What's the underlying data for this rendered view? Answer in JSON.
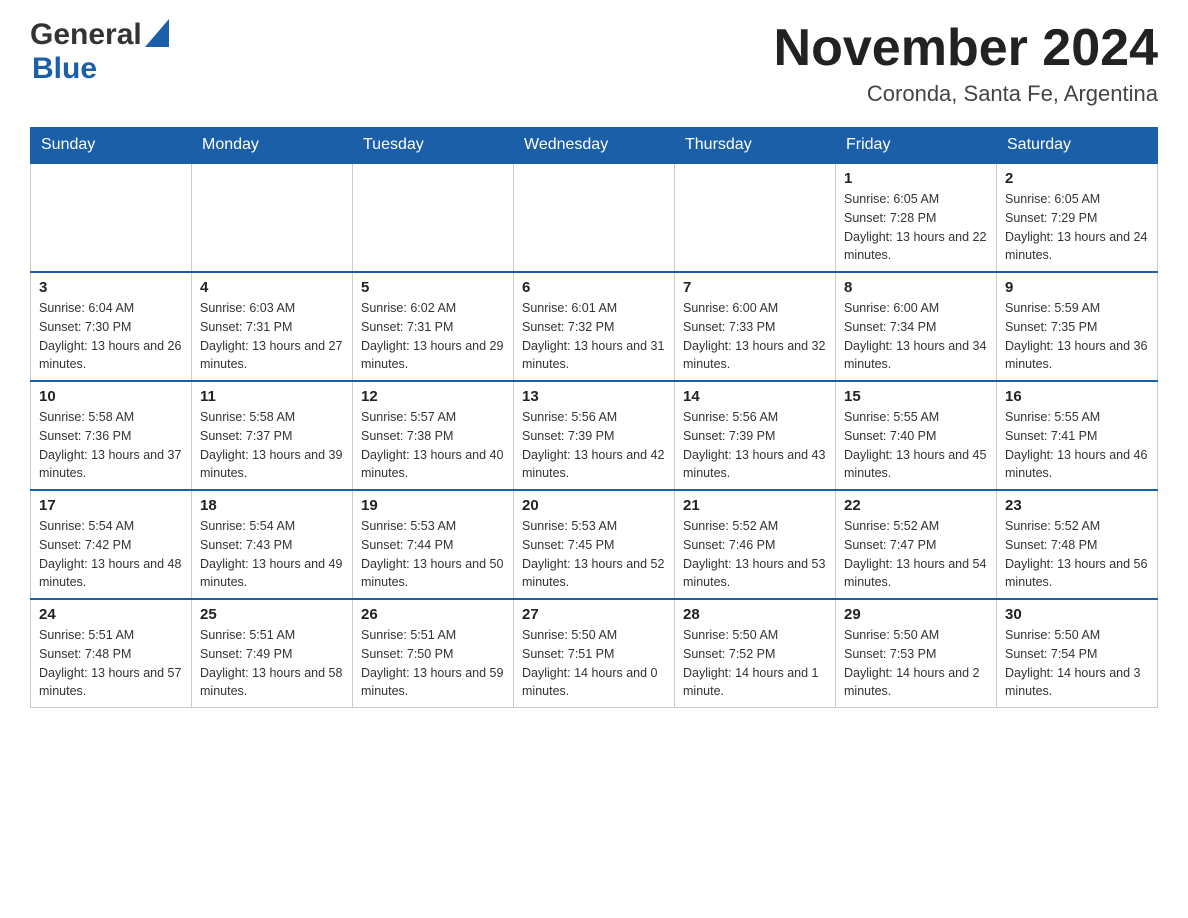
{
  "header": {
    "logo_general": "General",
    "logo_blue": "Blue",
    "month_title": "November 2024",
    "location": "Coronda, Santa Fe, Argentina"
  },
  "weekdays": [
    "Sunday",
    "Monday",
    "Tuesday",
    "Wednesday",
    "Thursday",
    "Friday",
    "Saturday"
  ],
  "weeks": [
    {
      "days": [
        {
          "num": "",
          "sunrise": "",
          "sunset": "",
          "daylight": ""
        },
        {
          "num": "",
          "sunrise": "",
          "sunset": "",
          "daylight": ""
        },
        {
          "num": "",
          "sunrise": "",
          "sunset": "",
          "daylight": ""
        },
        {
          "num": "",
          "sunrise": "",
          "sunset": "",
          "daylight": ""
        },
        {
          "num": "",
          "sunrise": "",
          "sunset": "",
          "daylight": ""
        },
        {
          "num": "1",
          "sunrise": "Sunrise: 6:05 AM",
          "sunset": "Sunset: 7:28 PM",
          "daylight": "Daylight: 13 hours and 22 minutes."
        },
        {
          "num": "2",
          "sunrise": "Sunrise: 6:05 AM",
          "sunset": "Sunset: 7:29 PM",
          "daylight": "Daylight: 13 hours and 24 minutes."
        }
      ]
    },
    {
      "days": [
        {
          "num": "3",
          "sunrise": "Sunrise: 6:04 AM",
          "sunset": "Sunset: 7:30 PM",
          "daylight": "Daylight: 13 hours and 26 minutes."
        },
        {
          "num": "4",
          "sunrise": "Sunrise: 6:03 AM",
          "sunset": "Sunset: 7:31 PM",
          "daylight": "Daylight: 13 hours and 27 minutes."
        },
        {
          "num": "5",
          "sunrise": "Sunrise: 6:02 AM",
          "sunset": "Sunset: 7:31 PM",
          "daylight": "Daylight: 13 hours and 29 minutes."
        },
        {
          "num": "6",
          "sunrise": "Sunrise: 6:01 AM",
          "sunset": "Sunset: 7:32 PM",
          "daylight": "Daylight: 13 hours and 31 minutes."
        },
        {
          "num": "7",
          "sunrise": "Sunrise: 6:00 AM",
          "sunset": "Sunset: 7:33 PM",
          "daylight": "Daylight: 13 hours and 32 minutes."
        },
        {
          "num": "8",
          "sunrise": "Sunrise: 6:00 AM",
          "sunset": "Sunset: 7:34 PM",
          "daylight": "Daylight: 13 hours and 34 minutes."
        },
        {
          "num": "9",
          "sunrise": "Sunrise: 5:59 AM",
          "sunset": "Sunset: 7:35 PM",
          "daylight": "Daylight: 13 hours and 36 minutes."
        }
      ]
    },
    {
      "days": [
        {
          "num": "10",
          "sunrise": "Sunrise: 5:58 AM",
          "sunset": "Sunset: 7:36 PM",
          "daylight": "Daylight: 13 hours and 37 minutes."
        },
        {
          "num": "11",
          "sunrise": "Sunrise: 5:58 AM",
          "sunset": "Sunset: 7:37 PM",
          "daylight": "Daylight: 13 hours and 39 minutes."
        },
        {
          "num": "12",
          "sunrise": "Sunrise: 5:57 AM",
          "sunset": "Sunset: 7:38 PM",
          "daylight": "Daylight: 13 hours and 40 minutes."
        },
        {
          "num": "13",
          "sunrise": "Sunrise: 5:56 AM",
          "sunset": "Sunset: 7:39 PM",
          "daylight": "Daylight: 13 hours and 42 minutes."
        },
        {
          "num": "14",
          "sunrise": "Sunrise: 5:56 AM",
          "sunset": "Sunset: 7:39 PM",
          "daylight": "Daylight: 13 hours and 43 minutes."
        },
        {
          "num": "15",
          "sunrise": "Sunrise: 5:55 AM",
          "sunset": "Sunset: 7:40 PM",
          "daylight": "Daylight: 13 hours and 45 minutes."
        },
        {
          "num": "16",
          "sunrise": "Sunrise: 5:55 AM",
          "sunset": "Sunset: 7:41 PM",
          "daylight": "Daylight: 13 hours and 46 minutes."
        }
      ]
    },
    {
      "days": [
        {
          "num": "17",
          "sunrise": "Sunrise: 5:54 AM",
          "sunset": "Sunset: 7:42 PM",
          "daylight": "Daylight: 13 hours and 48 minutes."
        },
        {
          "num": "18",
          "sunrise": "Sunrise: 5:54 AM",
          "sunset": "Sunset: 7:43 PM",
          "daylight": "Daylight: 13 hours and 49 minutes."
        },
        {
          "num": "19",
          "sunrise": "Sunrise: 5:53 AM",
          "sunset": "Sunset: 7:44 PM",
          "daylight": "Daylight: 13 hours and 50 minutes."
        },
        {
          "num": "20",
          "sunrise": "Sunrise: 5:53 AM",
          "sunset": "Sunset: 7:45 PM",
          "daylight": "Daylight: 13 hours and 52 minutes."
        },
        {
          "num": "21",
          "sunrise": "Sunrise: 5:52 AM",
          "sunset": "Sunset: 7:46 PM",
          "daylight": "Daylight: 13 hours and 53 minutes."
        },
        {
          "num": "22",
          "sunrise": "Sunrise: 5:52 AM",
          "sunset": "Sunset: 7:47 PM",
          "daylight": "Daylight: 13 hours and 54 minutes."
        },
        {
          "num": "23",
          "sunrise": "Sunrise: 5:52 AM",
          "sunset": "Sunset: 7:48 PM",
          "daylight": "Daylight: 13 hours and 56 minutes."
        }
      ]
    },
    {
      "days": [
        {
          "num": "24",
          "sunrise": "Sunrise: 5:51 AM",
          "sunset": "Sunset: 7:48 PM",
          "daylight": "Daylight: 13 hours and 57 minutes."
        },
        {
          "num": "25",
          "sunrise": "Sunrise: 5:51 AM",
          "sunset": "Sunset: 7:49 PM",
          "daylight": "Daylight: 13 hours and 58 minutes."
        },
        {
          "num": "26",
          "sunrise": "Sunrise: 5:51 AM",
          "sunset": "Sunset: 7:50 PM",
          "daylight": "Daylight: 13 hours and 59 minutes."
        },
        {
          "num": "27",
          "sunrise": "Sunrise: 5:50 AM",
          "sunset": "Sunset: 7:51 PM",
          "daylight": "Daylight: 14 hours and 0 minutes."
        },
        {
          "num": "28",
          "sunrise": "Sunrise: 5:50 AM",
          "sunset": "Sunset: 7:52 PM",
          "daylight": "Daylight: 14 hours and 1 minute."
        },
        {
          "num": "29",
          "sunrise": "Sunrise: 5:50 AM",
          "sunset": "Sunset: 7:53 PM",
          "daylight": "Daylight: 14 hours and 2 minutes."
        },
        {
          "num": "30",
          "sunrise": "Sunrise: 5:50 AM",
          "sunset": "Sunset: 7:54 PM",
          "daylight": "Daylight: 14 hours and 3 minutes."
        }
      ]
    }
  ]
}
